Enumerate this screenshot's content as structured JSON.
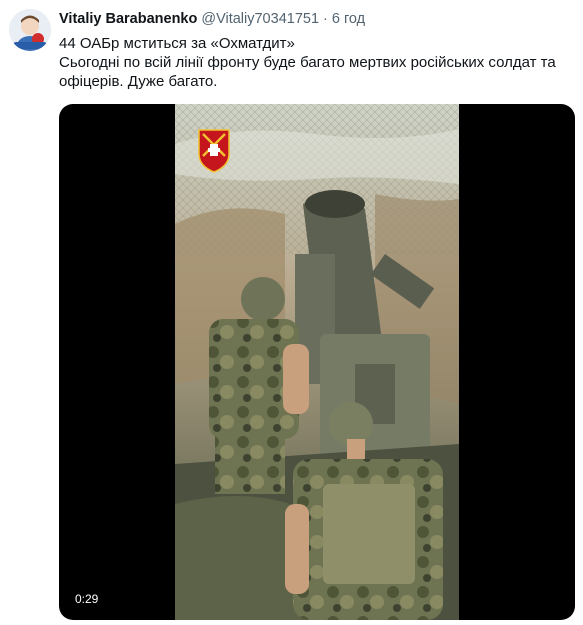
{
  "author": {
    "name": "Vitaliy Barabanenko",
    "handle": "@Vitaliy70341751",
    "separator": "·",
    "time": "6 год"
  },
  "tweet": {
    "lines": [
      "44 ОАБр мститься за «Охматдит»",
      "Сьогодні по всій лінії фронту буде багато мертвих російських солдат та офіцерів. Дуже багато."
    ]
  },
  "video": {
    "duration": "0:29"
  },
  "colors": {
    "text": "#0f1419",
    "secondary": "#536471",
    "badge_red": "#c4161c",
    "badge_gold": "#f2c230"
  }
}
